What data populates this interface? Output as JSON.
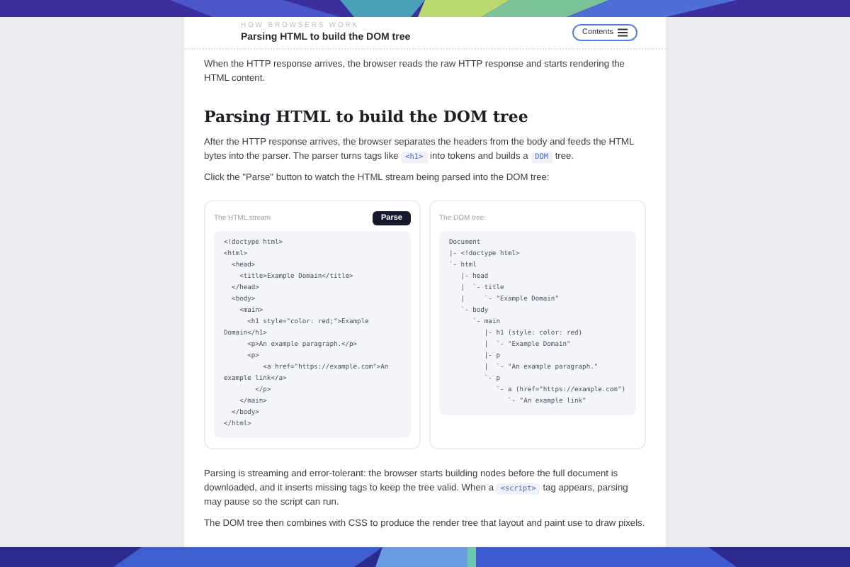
{
  "header": {
    "kicker": "HOW BROWSERS WORK",
    "title": "Parsing HTML to build the DOM tree",
    "contents_button": "Contents"
  },
  "intro": [
    {
      "kind": "text",
      "text": "When the HTTP response arrives, the browser reads the raw HTTP response and starts rendering the HTML content."
    }
  ],
  "heading": "Parsing HTML to build the DOM tree",
  "paragraphs_before": [
    [
      {
        "kind": "text",
        "text": "After the HTTP response arrives, the browser separates the headers from the body and feeds the HTML bytes into the parser. The parser turns tags like "
      },
      {
        "kind": "code",
        "text": "<h1>"
      },
      {
        "kind": "text",
        "text": " into tokens and builds a "
      },
      {
        "kind": "code",
        "text": "DOM"
      },
      {
        "kind": "text",
        "text": " tree."
      }
    ],
    [
      {
        "kind": "text",
        "text": "Click the \"Parse\" button to watch the HTML stream being parsed into the DOM tree:"
      }
    ]
  ],
  "html_panel": {
    "label": "The HTML stream",
    "button": "Parse",
    "lines": [
      "<!doctype html>",
      "<html>",
      "  <head>",
      "    <title>Example Domain</title>",
      "  </head>",
      "  <body>",
      "    <main>",
      "      <h1 style=\"color: red;\">Example Domain</h1>",
      "      <p>An example paragraph.</p>",
      "      <p>",
      "          <a href=\"https://example.com\">An example link</a>",
      "        </p>",
      "    </main>",
      "  </body>",
      "</html>"
    ]
  },
  "dom_panel": {
    "label": "The DOM tree",
    "lines": [
      "Document",
      "|- <!doctype html>",
      "`- html",
      "   |- head",
      "   |  `- title",
      "   |     `- \"Example Domain\"",
      "   `- body",
      "      `- main",
      "         |- h1 (style: color: red)",
      "         |  `- \"Example Domain\"",
      "         |- p",
      "         |  `- \"An example paragraph.\"",
      "         `- p",
      "            `- a (href=\"https://example.com\")",
      "               `- \"An example link\""
    ]
  },
  "paragraphs_after": [
    [
      {
        "kind": "text",
        "text": "Parsing is streaming and error-tolerant: the browser starts building nodes before the full document is downloaded, and it inserts missing tags to keep the tree valid. When a "
      },
      {
        "kind": "code",
        "text": "<script>"
      },
      {
        "kind": "text",
        "text": " tag appears, parsing may pause so the script can run."
      }
    ],
    [
      {
        "kind": "text",
        "text": "The DOM tree then combines with CSS to produce the render tree that layout and paint use to draw pixels."
      }
    ]
  ]
}
